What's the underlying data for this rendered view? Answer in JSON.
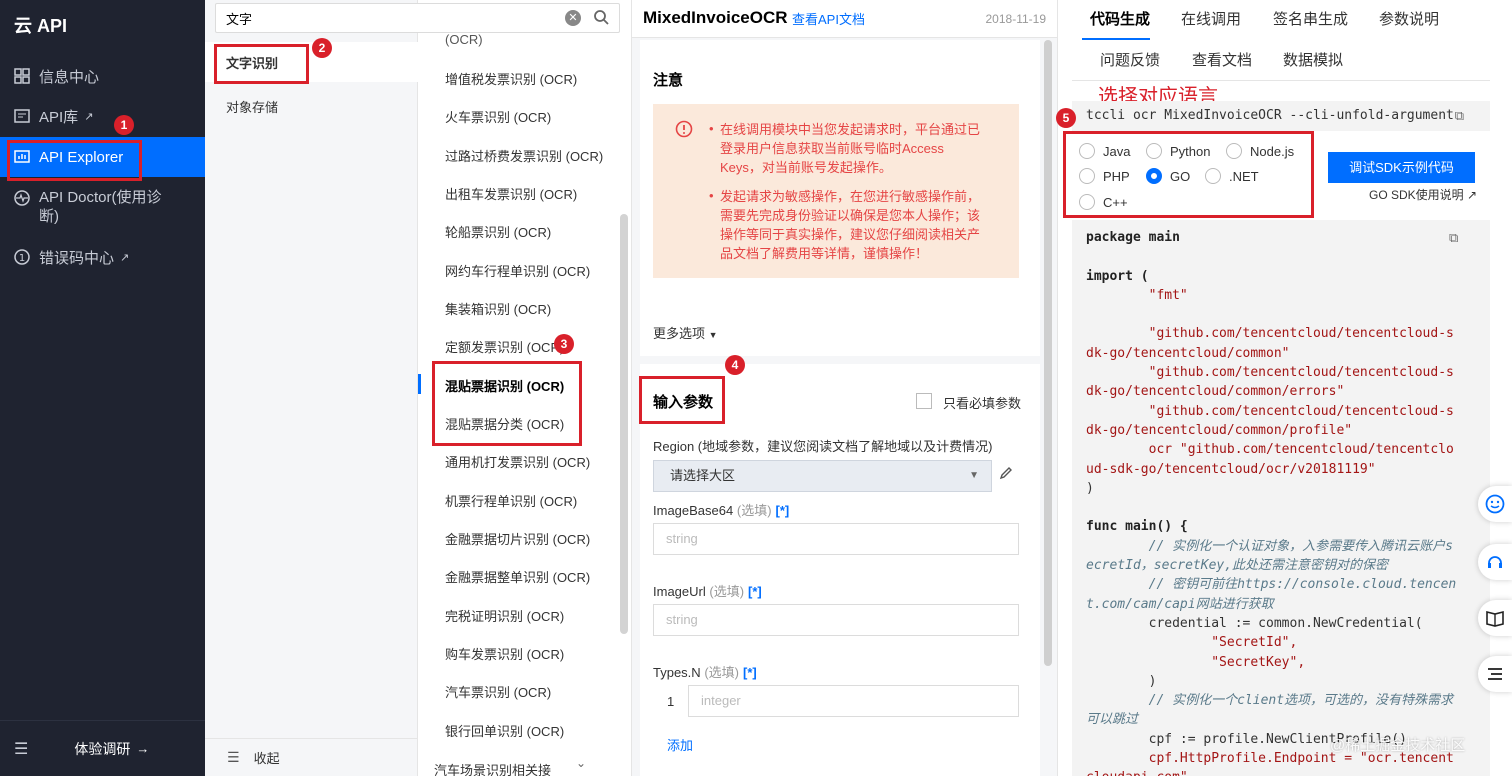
{
  "leftnav": {
    "logo": "云 API",
    "items": [
      {
        "label": "信息中心"
      },
      {
        "label": "API库"
      },
      {
        "label": "API Explorer"
      },
      {
        "label": "API Doctor(使用诊断)"
      },
      {
        "label": "错误码中心"
      }
    ],
    "footer": "体验调研"
  },
  "search": {
    "value": "文字"
  },
  "categories": [
    "文字识别",
    "对象存储"
  ],
  "collapse_label": "收起",
  "api_list": [
    "(OCR)",
    "增值税发票识别 (OCR)",
    "火车票识别 (OCR)",
    "过路过桥费发票识别 (OCR)",
    "出租车发票识别 (OCR)",
    "轮船票识别 (OCR)",
    "网约车行程单识别 (OCR)",
    "集装箱识别 (OCR)",
    "定额发票识别 (OCR)",
    "混贴票据识别 (OCR)",
    "混贴票据分类 (OCR)",
    "通用机打发票识别 (OCR)",
    "机票行程单识别 (OCR)",
    "金融票据切片识别 (OCR)",
    "金融票据整单识别 (OCR)",
    "完税证明识别 (OCR)",
    "购车发票识别 (OCR)",
    "汽车票识别 (OCR)",
    "银行回单识别 (OCR)"
  ],
  "api_group_label": "汽车场景识别相关接",
  "main": {
    "title": "MixedInvoiceOCR",
    "doc_link": "查看API文档",
    "date": "2018-11-19",
    "notice_title": "注意",
    "notice_1": "在线调用模块中当您发起请求时，平台通过已登录用户信息获取当前账号临时Access Keys，对当前账号发起操作。",
    "notice_2": "发起请求为敏感操作，在您进行敏感操作前，需要先完成身份验证以确保是您本人操作；该操作等同于真实操作，建议您仔细阅读相关产品文档了解费用等详情，谨慎操作！",
    "more_options": "更多选项",
    "input_params": "输入参数",
    "required_only": "只看必填参数",
    "region_label": "Region (地域参数，建议您阅读文档了解地域以及计费情况)",
    "region_select": "请选择大区",
    "imagebase64_label": "ImageBase64",
    "imageurl_label": "ImageUrl",
    "types_label": "Types.N",
    "optional": "(选填)",
    "star": "[*]",
    "string_placeholder": "string",
    "integer_placeholder": "integer",
    "types_index": "1",
    "add_label": "添加"
  },
  "right": {
    "tabs_row1": [
      "代码生成",
      "在线调用",
      "签名串生成",
      "参数说明"
    ],
    "tabs_row2": [
      "问题反馈",
      "查看文档",
      "数据模拟"
    ],
    "annotation_title": "选择对应语言",
    "cli": "tccli ocr MixedInvoiceOCR --cli-unfold-argument",
    "languages": [
      "Java",
      "Python",
      "Node.js",
      "PHP",
      "GO",
      ".NET",
      "C++"
    ],
    "selected_language": "GO",
    "debug_button": "调试SDK示例代码",
    "sdk_doc": "GO SDK使用说明",
    "watermark": "@稀土掘金技术社区"
  },
  "code_lines": [
    "package main",
    "",
    "import (",
    "        \"fmt\"",
    "",
    "        \"github.com/tencentcloud/tencentcloud-s",
    "dk-go/tencentcloud/common\"",
    "        \"github.com/tencentcloud/tencentcloud-s",
    "dk-go/tencentcloud/common/errors\"",
    "        \"github.com/tencentcloud/tencentcloud-s",
    "dk-go/tencentcloud/common/profile\"",
    "        ocr \"github.com/tencentcloud/tencentclo",
    "ud-sdk-go/tencentcloud/ocr/v20181119\"",
    ")",
    "",
    "func main() {",
    "        // 实例化一个认证对象，入参需要传入腾讯云账户s",
    "ecretId，secretKey,此处还需注意密钥对的保密",
    "        // 密钥可前往https://console.cloud.tencen",
    "t.com/cam/capi网站进行获取",
    "        credential := common.NewCredential(",
    "                \"SecretId\",",
    "                \"SecretKey\",",
    "        )",
    "        // 实例化一个client选项，可选的，没有特殊需求",
    "可以跳过",
    "        cpf := profile.NewClientProfile()",
    "        cpf.HttpProfile.Endpoint = \"ocr.tencent",
    "cloudapi.com\""
  ],
  "badges": [
    "1",
    "2",
    "3",
    "4",
    "5"
  ],
  "colors": {
    "accent": "#006eff",
    "annotation": "#d9202a",
    "nav_bg": "#1f2330"
  }
}
